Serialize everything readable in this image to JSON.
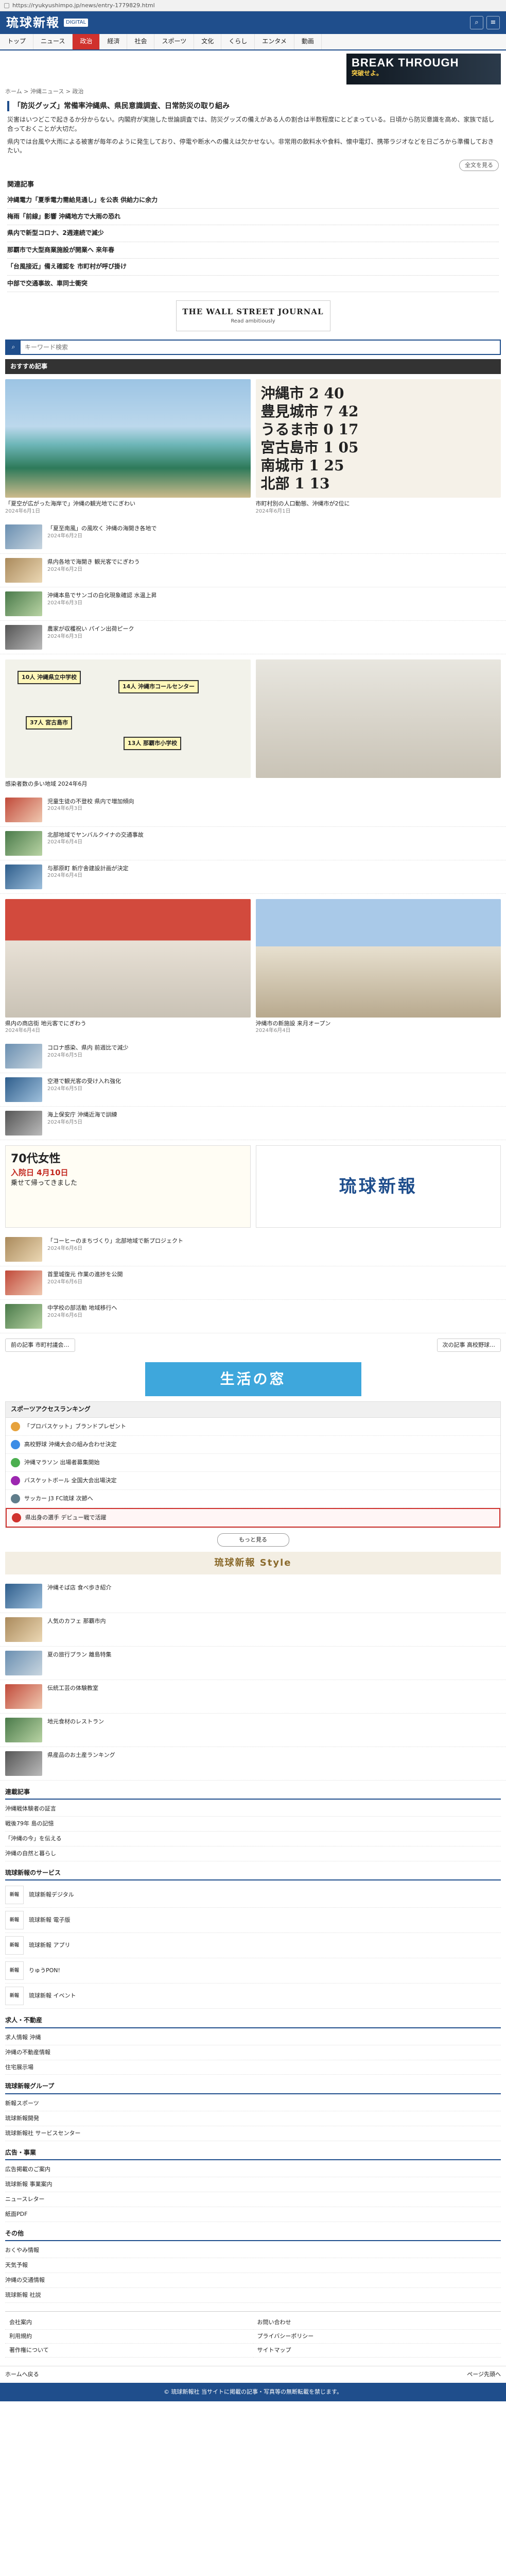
{
  "browser": {
    "url": "https://ryukyushimpo.jp/news/entry-1779829.html"
  },
  "header": {
    "logo": "琉球新報",
    "logo_sub": "DIGITAL",
    "icons": [
      "search-icon",
      "menu-icon"
    ]
  },
  "nav": {
    "tabs": [
      "トップ",
      "ニュース",
      "政治",
      "経済",
      "社会",
      "スポーツ",
      "文化",
      "くらし",
      "エンタメ",
      "動画"
    ]
  },
  "ad_top": {
    "line1": "BREAK THROUGH",
    "line2": "突破せよ。"
  },
  "breadcrumb": "ホーム > 沖縄ニュース > 政治",
  "article": {
    "title": "「防災グッズ」常備率沖縄県、県民意識調査、日常防災の取り組み",
    "paragraphs": [
      "災害はいつどこで起きるか分からない。内閣府が実施した世論調査では、防災グッズの備えがある人の割合は半数程度にとどまっている。日頃から防災意識を高め、家族で話し合っておくことが大切だ。",
      "県内では台風や大雨による被害が毎年のように発生しており、停電や断水への備えは欠かせない。非常用の飲料水や食料、懐中電灯、携帯ラジオなどを日ごろから準備しておきたい。"
    ],
    "more_label": "全文を見る"
  },
  "related": {
    "head": "関連記事",
    "items": [
      "沖縄電力「夏季電力需給見通し」を公表 供給力に余力",
      "梅雨「前線」影響 沖縄地方で大雨の恐れ",
      "県内で新型コロナ、2週連続で減少",
      "那覇市で大型商業施設が開業へ 来年春",
      "「台風接近」備え確認を 市町村が呼び掛け",
      "中部で交通事故、車同士衝突"
    ]
  },
  "ad_wsj": {
    "name": "THE WALL STREET JOURNAL",
    "tag": "Read ambitiously"
  },
  "search": {
    "placeholder": "キーワード検索"
  },
  "recommend": {
    "head": "おすすめ記事",
    "top_cards": [
      {
        "caption": "「夏空が広がった海岸で」沖縄の観光地でにぎわい",
        "date": "2024年6月1日"
      },
      {
        "caption": "市町村別の人口動態、沖縄市が2位に",
        "date": "2024年6月1日",
        "rows": [
          "沖縄市 2 40",
          "豊見城市 7 42",
          "うるま市 0 17",
          "宮古島市 1 05",
          "南城市 1 25",
          "北部 1 13"
        ]
      }
    ],
    "list_a": [
      {
        "title": "「夏至南風」の風吹く 沖縄の海開き各地で",
        "date": "2024年6月2日"
      },
      {
        "title": "県内各地で海開き 観光客でにぎわう",
        "date": "2024年6月2日"
      },
      {
        "title": "沖縄本島でサンゴの白化現象確認 水温上昇",
        "date": "2024年6月3日"
      },
      {
        "title": "農家が収穫祝い パイン出荷ピーク",
        "date": "2024年6月3日"
      }
    ],
    "map_pins": [
      "10人 沖縄県立中学校",
      "14人 沖縄市コールセンター",
      "37人 宮古島市",
      "13人 那覇市小学校"
    ],
    "map_caption": "感染者数の多い地域 2024年6月",
    "list_b": [
      {
        "title": "児童生徒の不登校 県内で増加傾向",
        "date": "2024年6月3日"
      },
      {
        "title": "北部地域でヤンバルクイナの交通事故",
        "date": "2024年6月4日"
      },
      {
        "title": "与那原町 新庁舎建設計画が決定",
        "date": "2024年6月4日"
      }
    ],
    "shop_cards": [
      {
        "caption": "県内の商店街 地元客でにぎわう",
        "date": "2024年6月4日"
      },
      {
        "caption": "沖縄市の新施設 来月オープン",
        "date": "2024年6月4日"
      }
    ],
    "list_c": [
      {
        "title": "コロナ感染、県内 前週比で減少",
        "date": "2024年6月5日"
      },
      {
        "title": "空港で観光客の受け入れ強化",
        "date": "2024年6月5日"
      },
      {
        "title": "海上保安庁 沖縄近海で訓練",
        "date": "2024年6月5日"
      }
    ],
    "pr_left": {
      "age": "70代女性",
      "highlight": "入院日 4月10日",
      "sub": "乗せて帰ってきました"
    },
    "pr_right": {
      "brand": "琉球新報"
    },
    "list_d": [
      {
        "title": "「コーヒーのまちづくり」北部地域で新プロジェクト",
        "date": "2024年6月6日"
      },
      {
        "title": "首里城復元 作業の進捗を公開",
        "date": "2024年6月6日"
      },
      {
        "title": "中学校の部活動 地域移行へ",
        "date": "2024年6月6日"
      }
    ]
  },
  "pager": {
    "prev": "前の記事 市町村議会…",
    "next": "次の記事 高校野球…"
  },
  "life_banner": "生活の窓",
  "services": {
    "head": "スポーツアクセスランキング",
    "items": [
      "「プロバスケット」ブランドプレゼント",
      "高校野球 沖縄大会の組み合わせ決定",
      "沖縄マラソン 出場者募集開始",
      "バスケットボール 全国大会出場決定",
      "サッカー J3 FC琉球 次節へ",
      "県出身の選手 デビュー戦で活躍"
    ],
    "more_label": "もっと見る"
  },
  "style": {
    "banner": "琉球新報 Style",
    "items": [
      "沖縄そば店 食べ歩き紹介",
      "人気のカフェ 那覇市内",
      "夏の旅行プラン 離島特集",
      "伝統工芸の体験教室",
      "地元食材のレストラン",
      "県産品のお土産ランキング"
    ]
  },
  "sections": [
    {
      "head": "連載記事",
      "items": [
        "沖縄戦体験者の証言",
        "戦後79年 島の記憶",
        "「沖縄の今」を伝える",
        "沖縄の自然と暮らし"
      ]
    },
    {
      "head": "琉球新報のサービス",
      "items": [
        "琉球新報デジタル",
        "琉球新報 電子版",
        "琉球新報 アプリ",
        "りゅうPON!",
        "琉球新報 イベント"
      ]
    },
    {
      "head": "求人・不動産",
      "items": [
        "求人情報 沖縄",
        "沖縄の不動産情報",
        "住宅展示場"
      ]
    },
    {
      "head": "琉球新報グループ",
      "items": [
        "新報スポーツ",
        "琉球新報開発",
        "琉球新報社 サービスセンター"
      ]
    },
    {
      "head": "広告・事業",
      "items": [
        "広告掲載のご案内",
        "琉球新報 事業案内",
        "ニュースレター",
        "紙面PDF"
      ]
    },
    {
      "head": "その他",
      "items": [
        "おくやみ情報",
        "天気予報",
        "沖縄の交通情報",
        "琉球新報 社説"
      ]
    }
  ],
  "footer_links": [
    "会社案内",
    "お問い合わせ",
    "利用規約",
    "プライバシーポリシー",
    "著作権について",
    "サイトマップ"
  ],
  "totop": {
    "left": "ホームへ戻る",
    "right": "ページ先頭へ"
  },
  "footer": {
    "copy": "© 琉球新報社 当サイトに掲載の記事・写真等の無断転載を禁じます。"
  }
}
